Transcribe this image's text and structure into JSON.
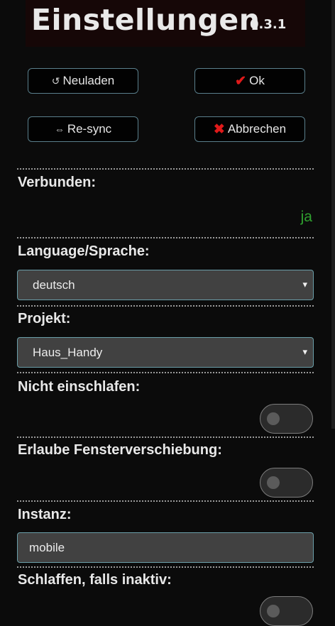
{
  "header": {
    "title": "Einstellungen",
    "version": "0.3.1"
  },
  "buttons": {
    "reload": {
      "icon": "reload-icon",
      "symbol": "↺",
      "label": "Neuladen"
    },
    "ok": {
      "icon": "checkmark-icon",
      "symbol": "✔",
      "label": "Ok",
      "icon_color": "#e01a1a"
    },
    "resync": {
      "icon": "left-right-arrow-icon",
      "symbol": "⇔",
      "label": "Re-sync"
    },
    "cancel": {
      "icon": "cross-icon",
      "symbol": "✖",
      "label": "Abbrechen",
      "icon_color": "#e01a1a"
    }
  },
  "settings": {
    "connected": {
      "label": "Verbunden:",
      "value": "ja",
      "value_color": "#2fa02f"
    },
    "language": {
      "label": "Language/Sprache:",
      "selected": "deutsch"
    },
    "project": {
      "label": "Projekt:",
      "selected": "Haus_Handy"
    },
    "keep_awake": {
      "label": "Nicht einschlafen:",
      "enabled": false
    },
    "allow_window_move": {
      "label": "Erlaube Fensterverschiebung:",
      "enabled": false
    },
    "instance": {
      "label": "Instanz:",
      "value": "mobile"
    },
    "sleep_when_inactive": {
      "label": "Schlaffen, falls inaktiv:"
    }
  },
  "icons": {
    "select_caret": "▾"
  },
  "colors": {
    "accent_border": "#6a9ea8",
    "button_border": "#5a7f8c",
    "status_ok": "#2fa02f"
  }
}
